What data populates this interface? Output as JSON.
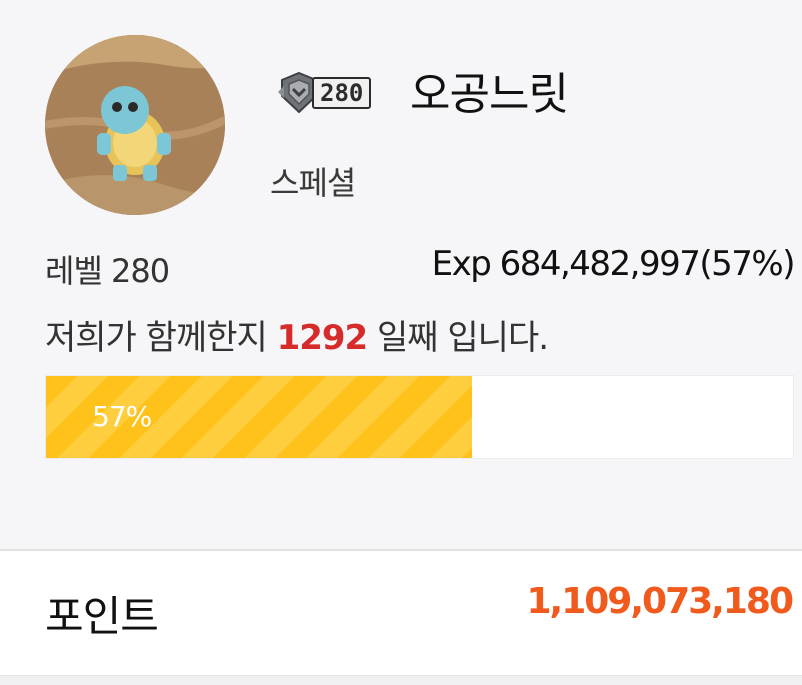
{
  "profile": {
    "level_badge_number": "280",
    "nickname": "오공느릿",
    "grade": "스페셜",
    "level_text": "레벨 280",
    "exp_text": "Exp 684,482,997(57%)",
    "days_prefix": "저희가 함께한지 ",
    "days_count": "1292",
    "days_suffix": " 일째 입니다.",
    "progress_percent": 57,
    "progress_label": "57%",
    "progress_color": "#ffc21a"
  },
  "points": {
    "label": "포인트",
    "value": "1,109,073,180",
    "value_color": "#f05a1c"
  },
  "icons": {
    "avatar": "squirtle-avatar-image",
    "badge": "shield-level-icon"
  }
}
